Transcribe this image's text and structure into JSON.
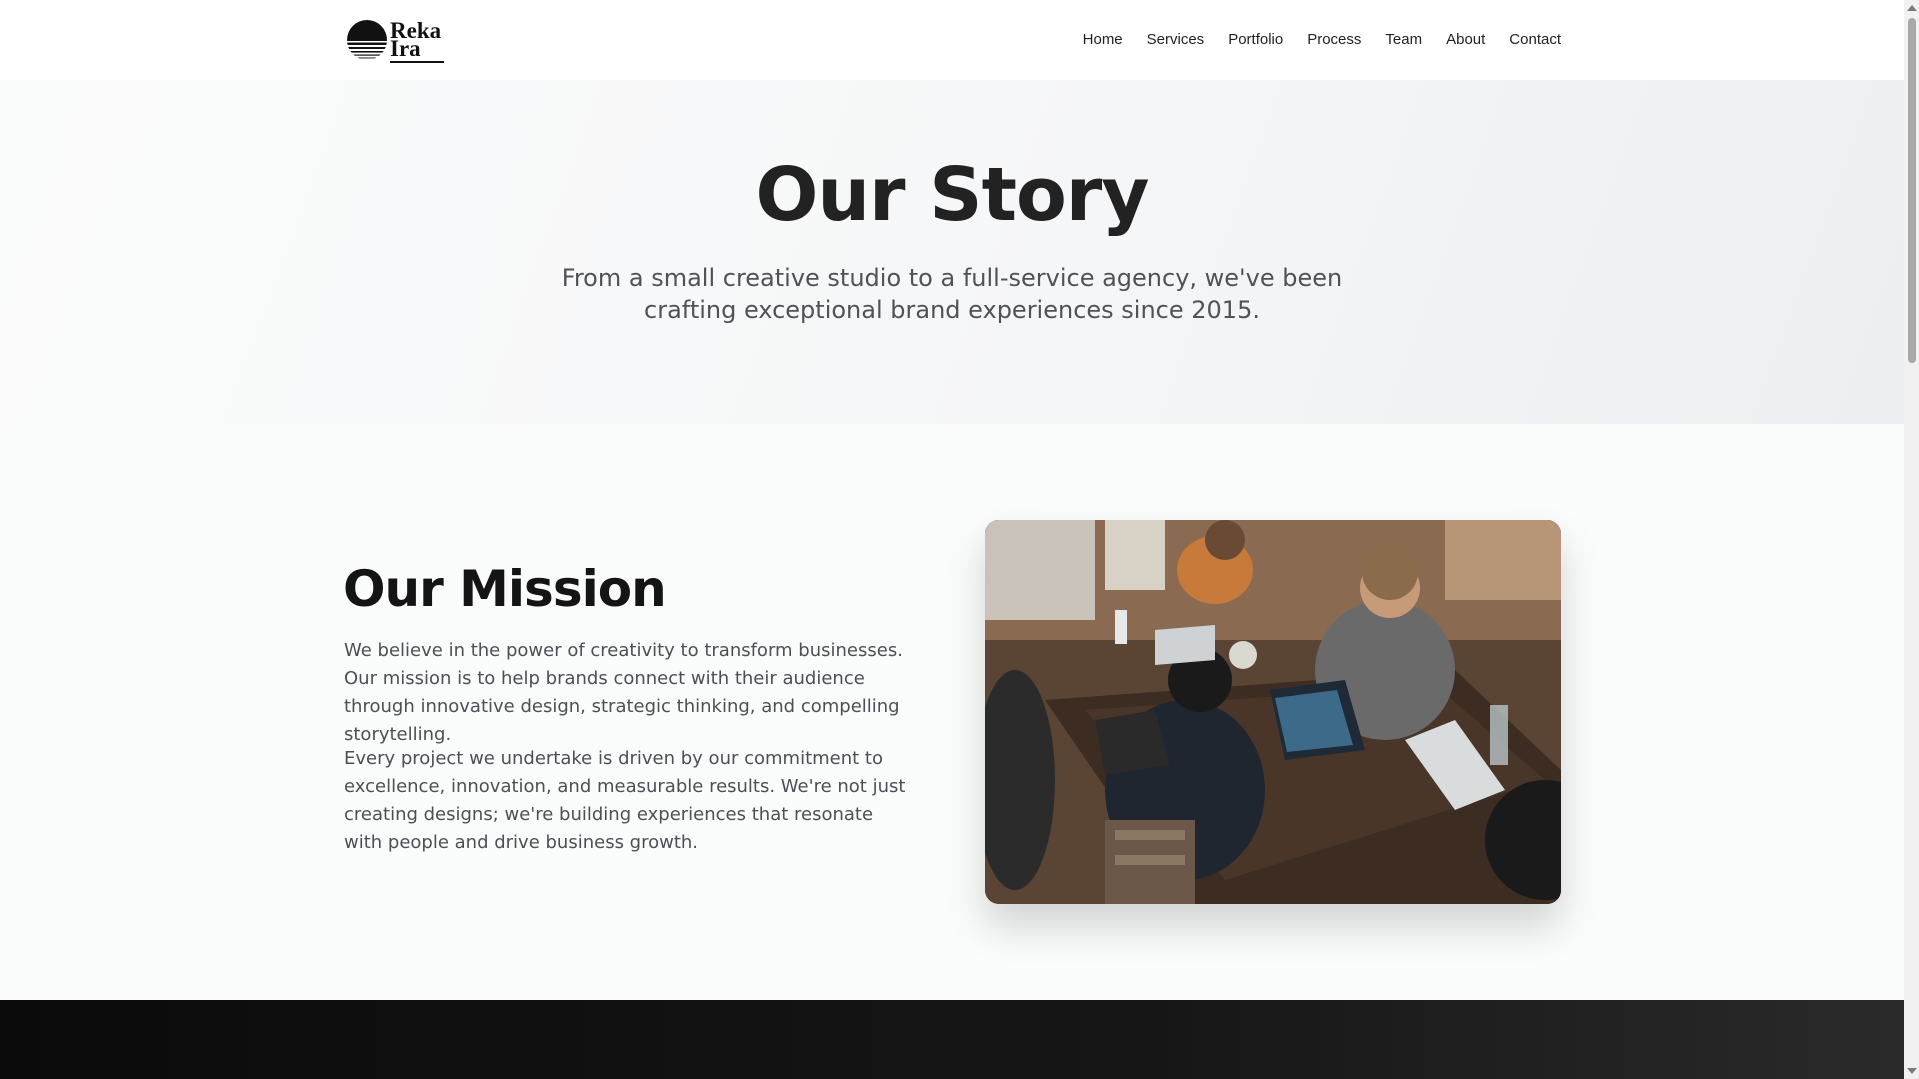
{
  "brand": {
    "line1": "Reka",
    "line2": "Ira",
    "logo_icon": "sun-horizon-icon"
  },
  "nav": {
    "items": [
      {
        "label": "Home"
      },
      {
        "label": "Services"
      },
      {
        "label": "Portfolio"
      },
      {
        "label": "Process"
      },
      {
        "label": "Team"
      },
      {
        "label": "About"
      },
      {
        "label": "Contact"
      }
    ]
  },
  "hero": {
    "title": "Our Story",
    "subtitle": "From a small creative studio to a full-service agency, we've been crafting exceptional brand experiences since 2015."
  },
  "mission": {
    "title": "Our Mission",
    "paragraph1": "We believe in the power of creativity to transform businesses. Our mission is to help brands connect with their audience through innovative design, strategic thinking, and compelling storytelling.",
    "paragraph2": "Every project we undertake is driven by our commitment to excellence, innovation, and measurable results. We're not just creating designs; we're building experiences that resonate with people and drive business growth.",
    "image_subject": "team-working-on-laptops-photo"
  },
  "colors": {
    "text_dark": "#141414",
    "text_muted": "#4c4f55",
    "hero_bg": "#f6f7f8",
    "dark_band": "#111111"
  }
}
